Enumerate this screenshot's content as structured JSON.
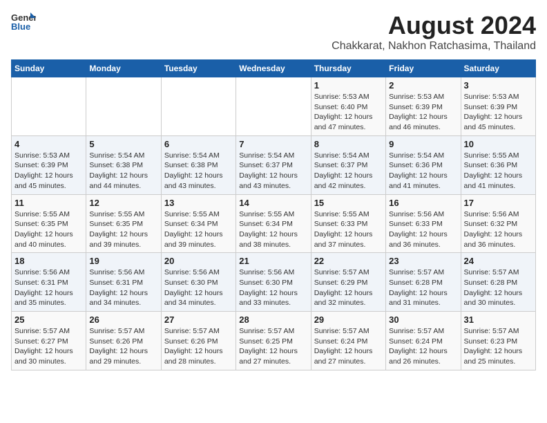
{
  "logo": {
    "line1": "General",
    "line2": "Blue"
  },
  "header": {
    "month_year": "August 2024",
    "location": "Chakkarat, Nakhon Ratchasima, Thailand"
  },
  "weekdays": [
    "Sunday",
    "Monday",
    "Tuesday",
    "Wednesday",
    "Thursday",
    "Friday",
    "Saturday"
  ],
  "weeks": [
    [
      {
        "day": "",
        "info": ""
      },
      {
        "day": "",
        "info": ""
      },
      {
        "day": "",
        "info": ""
      },
      {
        "day": "",
        "info": ""
      },
      {
        "day": "1",
        "info": "Sunrise: 5:53 AM\nSunset: 6:40 PM\nDaylight: 12 hours\nand 47 minutes."
      },
      {
        "day": "2",
        "info": "Sunrise: 5:53 AM\nSunset: 6:39 PM\nDaylight: 12 hours\nand 46 minutes."
      },
      {
        "day": "3",
        "info": "Sunrise: 5:53 AM\nSunset: 6:39 PM\nDaylight: 12 hours\nand 45 minutes."
      }
    ],
    [
      {
        "day": "4",
        "info": "Sunrise: 5:53 AM\nSunset: 6:39 PM\nDaylight: 12 hours\nand 45 minutes."
      },
      {
        "day": "5",
        "info": "Sunrise: 5:54 AM\nSunset: 6:38 PM\nDaylight: 12 hours\nand 44 minutes."
      },
      {
        "day": "6",
        "info": "Sunrise: 5:54 AM\nSunset: 6:38 PM\nDaylight: 12 hours\nand 43 minutes."
      },
      {
        "day": "7",
        "info": "Sunrise: 5:54 AM\nSunset: 6:37 PM\nDaylight: 12 hours\nand 43 minutes."
      },
      {
        "day": "8",
        "info": "Sunrise: 5:54 AM\nSunset: 6:37 PM\nDaylight: 12 hours\nand 42 minutes."
      },
      {
        "day": "9",
        "info": "Sunrise: 5:54 AM\nSunset: 6:36 PM\nDaylight: 12 hours\nand 41 minutes."
      },
      {
        "day": "10",
        "info": "Sunrise: 5:55 AM\nSunset: 6:36 PM\nDaylight: 12 hours\nand 41 minutes."
      }
    ],
    [
      {
        "day": "11",
        "info": "Sunrise: 5:55 AM\nSunset: 6:35 PM\nDaylight: 12 hours\nand 40 minutes."
      },
      {
        "day": "12",
        "info": "Sunrise: 5:55 AM\nSunset: 6:35 PM\nDaylight: 12 hours\nand 39 minutes."
      },
      {
        "day": "13",
        "info": "Sunrise: 5:55 AM\nSunset: 6:34 PM\nDaylight: 12 hours\nand 39 minutes."
      },
      {
        "day": "14",
        "info": "Sunrise: 5:55 AM\nSunset: 6:34 PM\nDaylight: 12 hours\nand 38 minutes."
      },
      {
        "day": "15",
        "info": "Sunrise: 5:55 AM\nSunset: 6:33 PM\nDaylight: 12 hours\nand 37 minutes."
      },
      {
        "day": "16",
        "info": "Sunrise: 5:56 AM\nSunset: 6:33 PM\nDaylight: 12 hours\nand 36 minutes."
      },
      {
        "day": "17",
        "info": "Sunrise: 5:56 AM\nSunset: 6:32 PM\nDaylight: 12 hours\nand 36 minutes."
      }
    ],
    [
      {
        "day": "18",
        "info": "Sunrise: 5:56 AM\nSunset: 6:31 PM\nDaylight: 12 hours\nand 35 minutes."
      },
      {
        "day": "19",
        "info": "Sunrise: 5:56 AM\nSunset: 6:31 PM\nDaylight: 12 hours\nand 34 minutes."
      },
      {
        "day": "20",
        "info": "Sunrise: 5:56 AM\nSunset: 6:30 PM\nDaylight: 12 hours\nand 34 minutes."
      },
      {
        "day": "21",
        "info": "Sunrise: 5:56 AM\nSunset: 6:30 PM\nDaylight: 12 hours\nand 33 minutes."
      },
      {
        "day": "22",
        "info": "Sunrise: 5:57 AM\nSunset: 6:29 PM\nDaylight: 12 hours\nand 32 minutes."
      },
      {
        "day": "23",
        "info": "Sunrise: 5:57 AM\nSunset: 6:28 PM\nDaylight: 12 hours\nand 31 minutes."
      },
      {
        "day": "24",
        "info": "Sunrise: 5:57 AM\nSunset: 6:28 PM\nDaylight: 12 hours\nand 30 minutes."
      }
    ],
    [
      {
        "day": "25",
        "info": "Sunrise: 5:57 AM\nSunset: 6:27 PM\nDaylight: 12 hours\nand 30 minutes."
      },
      {
        "day": "26",
        "info": "Sunrise: 5:57 AM\nSunset: 6:26 PM\nDaylight: 12 hours\nand 29 minutes."
      },
      {
        "day": "27",
        "info": "Sunrise: 5:57 AM\nSunset: 6:26 PM\nDaylight: 12 hours\nand 28 minutes."
      },
      {
        "day": "28",
        "info": "Sunrise: 5:57 AM\nSunset: 6:25 PM\nDaylight: 12 hours\nand 27 minutes."
      },
      {
        "day": "29",
        "info": "Sunrise: 5:57 AM\nSunset: 6:24 PM\nDaylight: 12 hours\nand 27 minutes."
      },
      {
        "day": "30",
        "info": "Sunrise: 5:57 AM\nSunset: 6:24 PM\nDaylight: 12 hours\nand 26 minutes."
      },
      {
        "day": "31",
        "info": "Sunrise: 5:57 AM\nSunset: 6:23 PM\nDaylight: 12 hours\nand 25 minutes."
      }
    ]
  ]
}
